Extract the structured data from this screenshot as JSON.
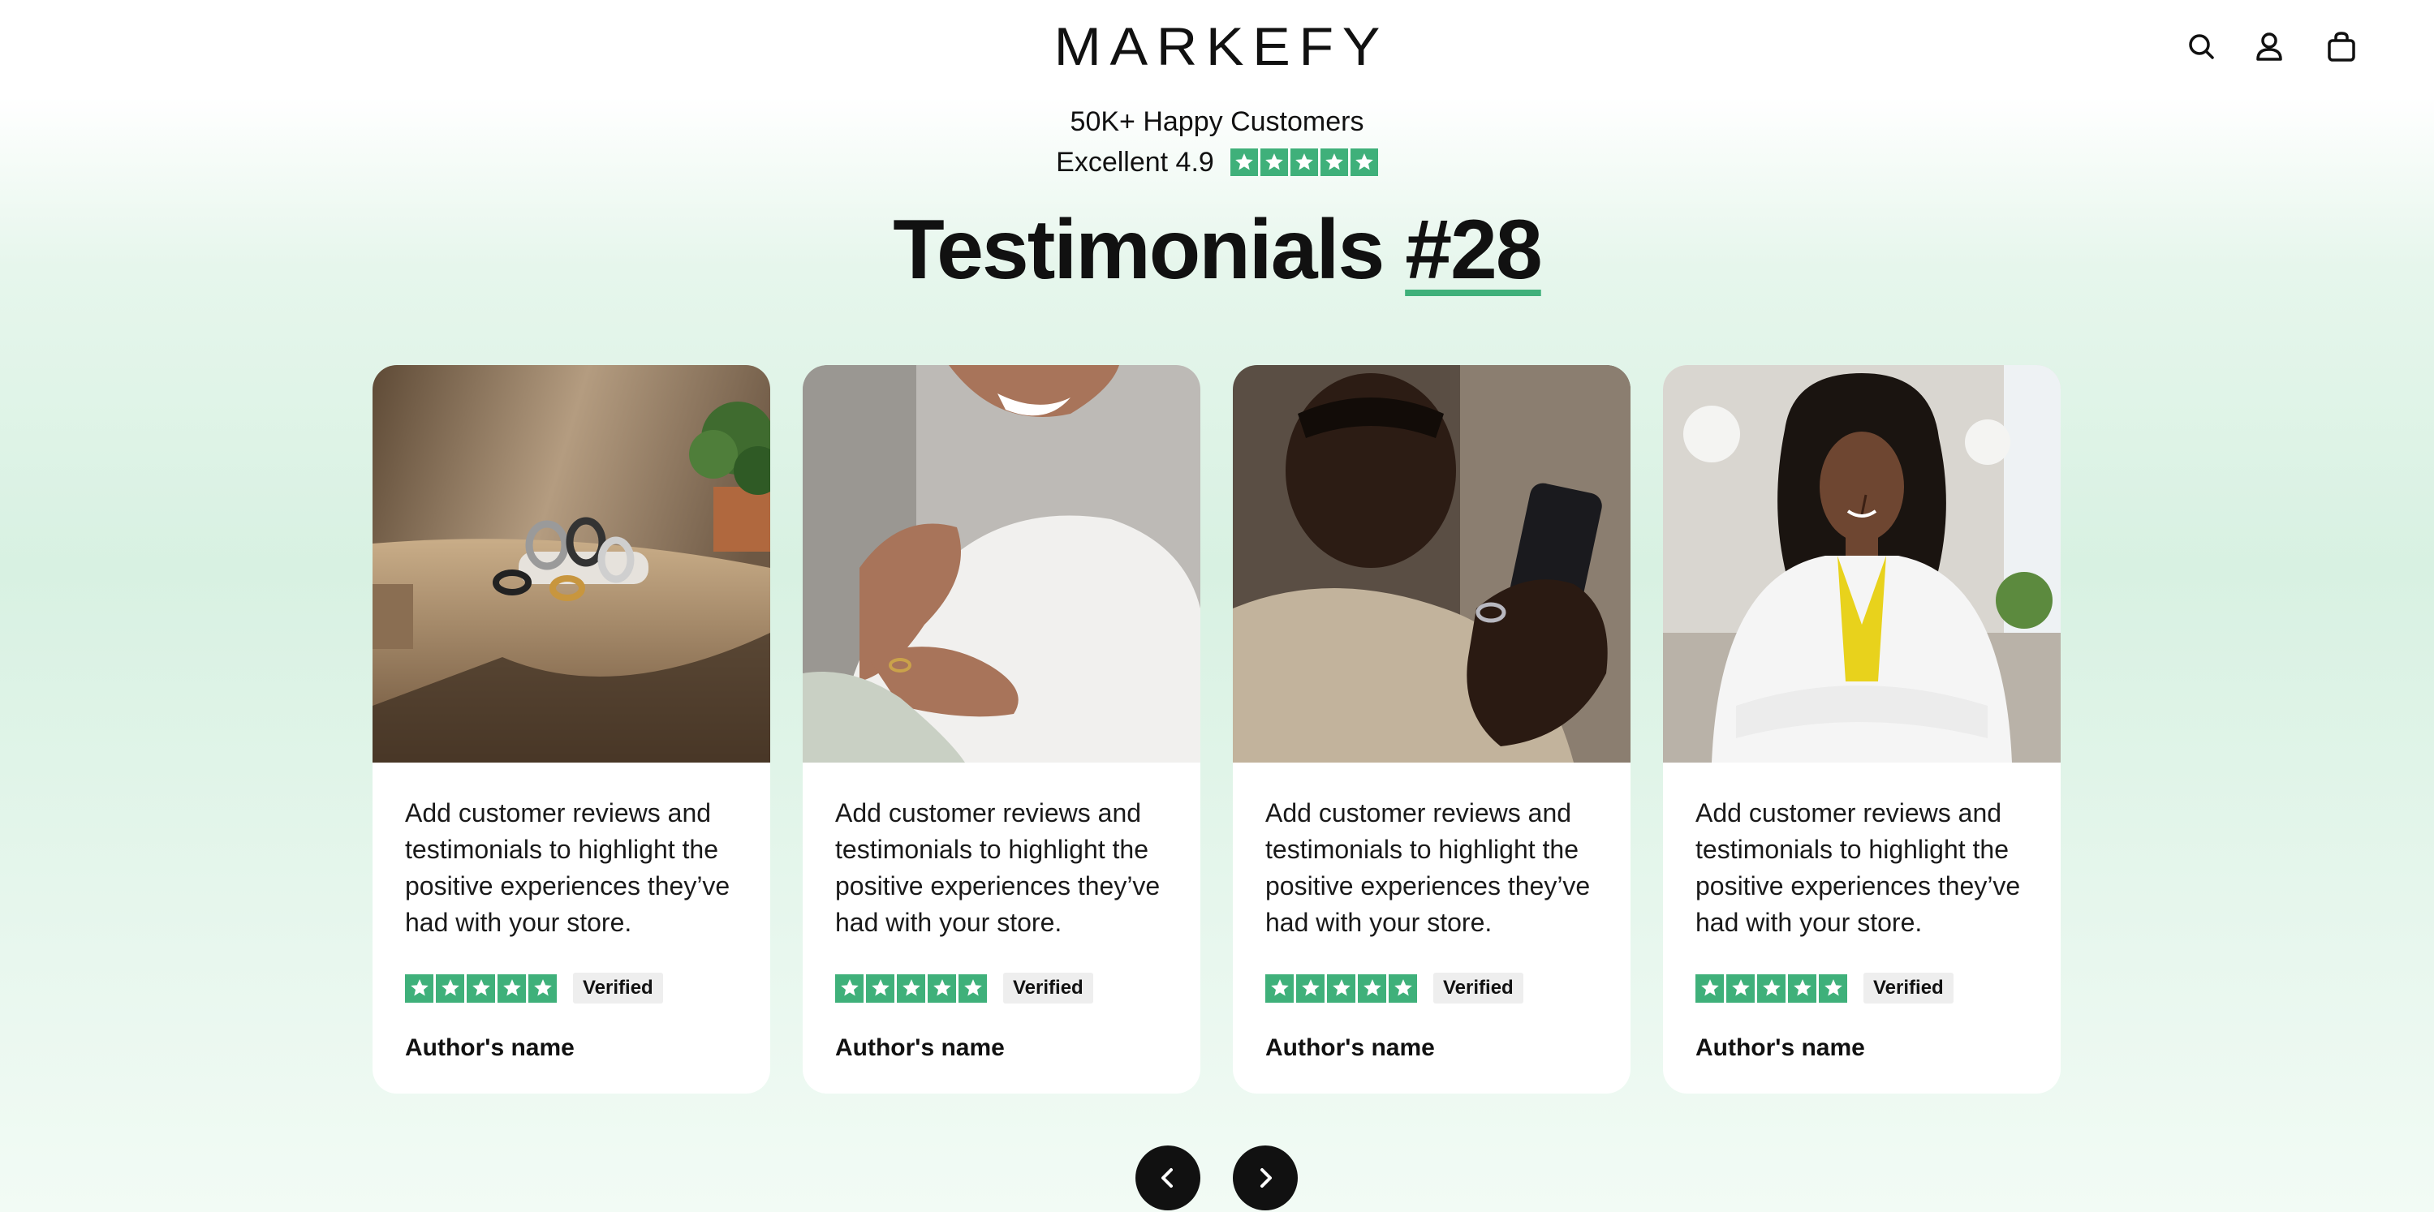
{
  "header": {
    "logo_text": "MARKEFY",
    "icons": [
      "search-icon",
      "account-icon",
      "cart-icon"
    ]
  },
  "rating": {
    "customers": "50K+ Happy Customers",
    "excellent": "Excellent 4.9",
    "stars": 5
  },
  "headline": {
    "title": "Testimonials",
    "number": "#28"
  },
  "testimonials": [
    {
      "text": "Add customer reviews and testimonials to highlight the positive experiences they’ve had with your store.",
      "verified": "Verified",
      "author": "Author's name",
      "stars": 5
    },
    {
      "text": "Add customer reviews and testimonials to highlight the positive experiences they’ve had with your store.",
      "verified": "Verified",
      "author": "Author's name",
      "stars": 5
    },
    {
      "text": "Add customer reviews and testimonials to highlight the positive experiences they’ve had with your store.",
      "verified": "Verified",
      "author": "Author's name",
      "stars": 5
    },
    {
      "text": "Add customer reviews and testimonials to highlight the positive experiences they’ve had with your store.",
      "verified": "Verified",
      "author": "Author's name",
      "stars": 5
    }
  ],
  "colors": {
    "accent_green": "#3fb07a",
    "dark": "#111111"
  }
}
